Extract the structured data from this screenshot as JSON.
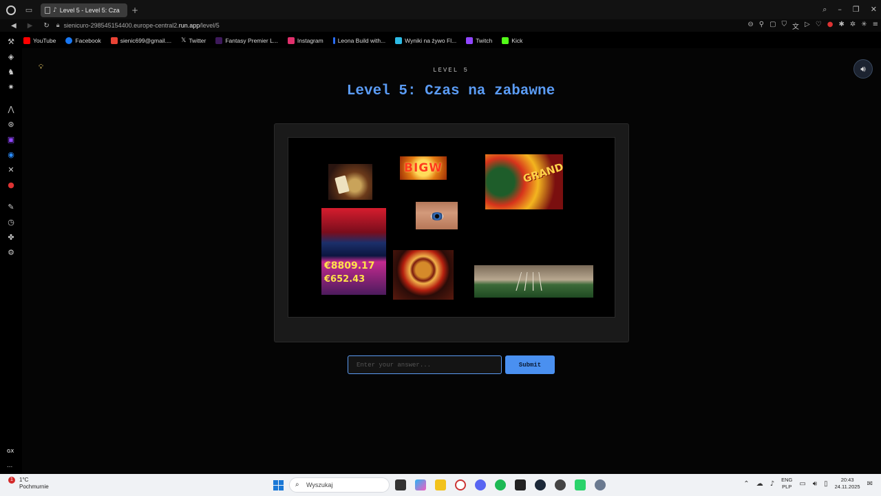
{
  "browser": {
    "tab_title": "Level 5 - Level 5: Cza",
    "address": {
      "prefix": "sienicuro-298545154400.europe-central2.",
      "host": "run.app",
      "path": "/level/5"
    },
    "bookmarks": [
      {
        "label": "YouTube",
        "color": "#ff0000"
      },
      {
        "label": "Facebook",
        "color": "#1877f2"
      },
      {
        "label": "sienic699@gmail....",
        "color": "#ea4335"
      },
      {
        "label": "Twitter",
        "color": "#ffffff"
      },
      {
        "label": "Fantasy Premier L...",
        "color": "#3d195b"
      },
      {
        "label": "Instagram",
        "color": "#e1306c"
      },
      {
        "label": "Leona Build with...",
        "color": "#2a6df4"
      },
      {
        "label": "Wyniki na żywo Fl...",
        "color": "#2dbbe5"
      },
      {
        "label": "Twitch",
        "color": "#9146ff"
      },
      {
        "label": "Kick",
        "color": "#53fc18"
      }
    ]
  },
  "sidebar": {
    "gx_label": "GX",
    "more_label": "..."
  },
  "page": {
    "kicker": "LEVEL 5",
    "title": "Level 5: Czas na zabawne",
    "puzzle": {
      "bigwin_text": "BIGW",
      "grand_text": "GRAND",
      "slot_amount_1": "€8809.17",
      "slot_amount_2": "€652.43"
    },
    "answer": {
      "placeholder": "Enter your answer..."
    },
    "submit_label": "Submit",
    "accent": "#5b9cf5"
  },
  "taskbar": {
    "weather_temp": "1°C",
    "weather_desc": "Pochmurnie",
    "weather_badge": "1",
    "search_placeholder": "Wyszukaj",
    "lang_top": "ENG",
    "lang_bottom": "PLP",
    "time": "20:43",
    "date": "24.11.2025"
  }
}
